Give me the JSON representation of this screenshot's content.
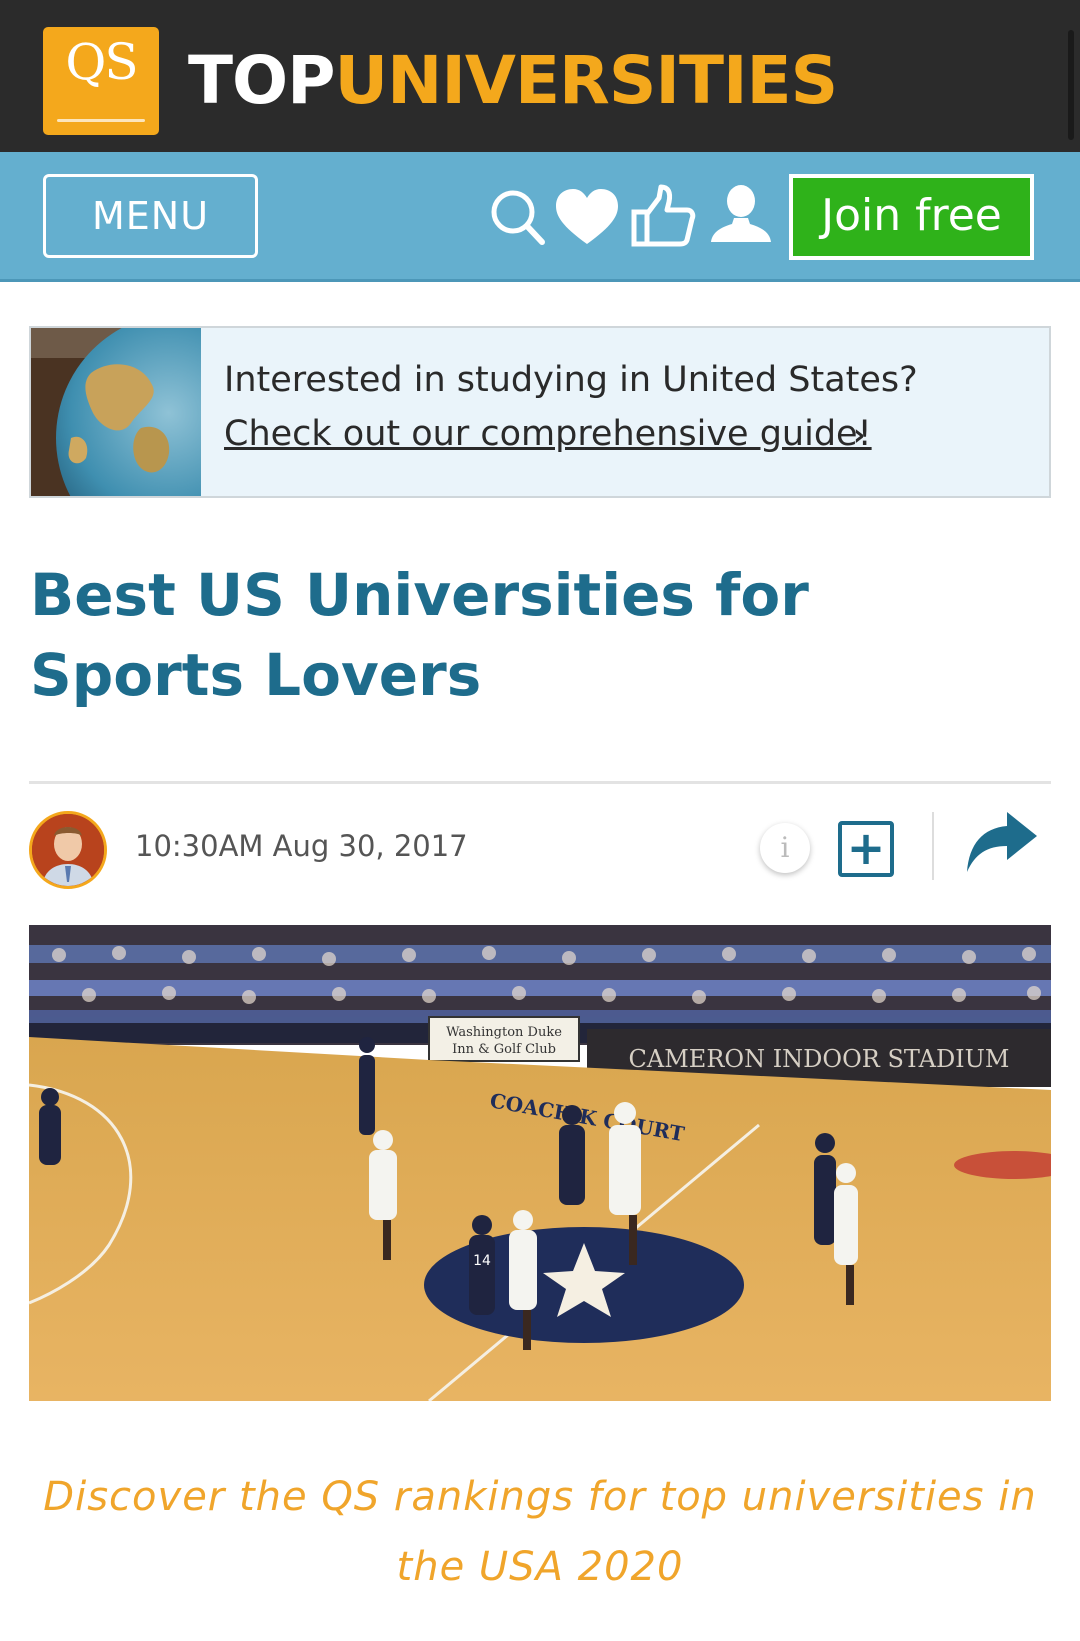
{
  "header": {
    "logo_text": "QS",
    "brand_top": "TOP",
    "brand_universities": "UNIVERSITIES"
  },
  "nav": {
    "menu_label": "MENU",
    "icons": [
      "search-icon",
      "heart-icon",
      "thumbs-up-icon",
      "user-icon"
    ],
    "join_label": "Join free"
  },
  "promo": {
    "title": "Interested in studying in United States?",
    "link": "Check out our comprehensive guide!",
    "chevron": "›"
  },
  "article": {
    "title": "Best US Universities for Sports Lovers",
    "timestamp": "10:30AM Aug 30, 2017",
    "info_label": "i",
    "add_label": "+",
    "caption": "Discover the QS rankings for top universities in the USA 2020"
  },
  "hero": {
    "sponsor_line1": "Washington Duke",
    "sponsor_line2": "Inn & Golf Club",
    "arena_name": "CAMERON INDOOR STADIUM",
    "court_text": "COACH K COURT",
    "player_number": "14"
  },
  "colors": {
    "topbar": "#2b2b2b",
    "brand_accent": "#f4a81c",
    "navbar": "#64afcf",
    "join_green": "#2fb21a",
    "headline": "#1e6c8c",
    "caption": "#f0a52b"
  }
}
